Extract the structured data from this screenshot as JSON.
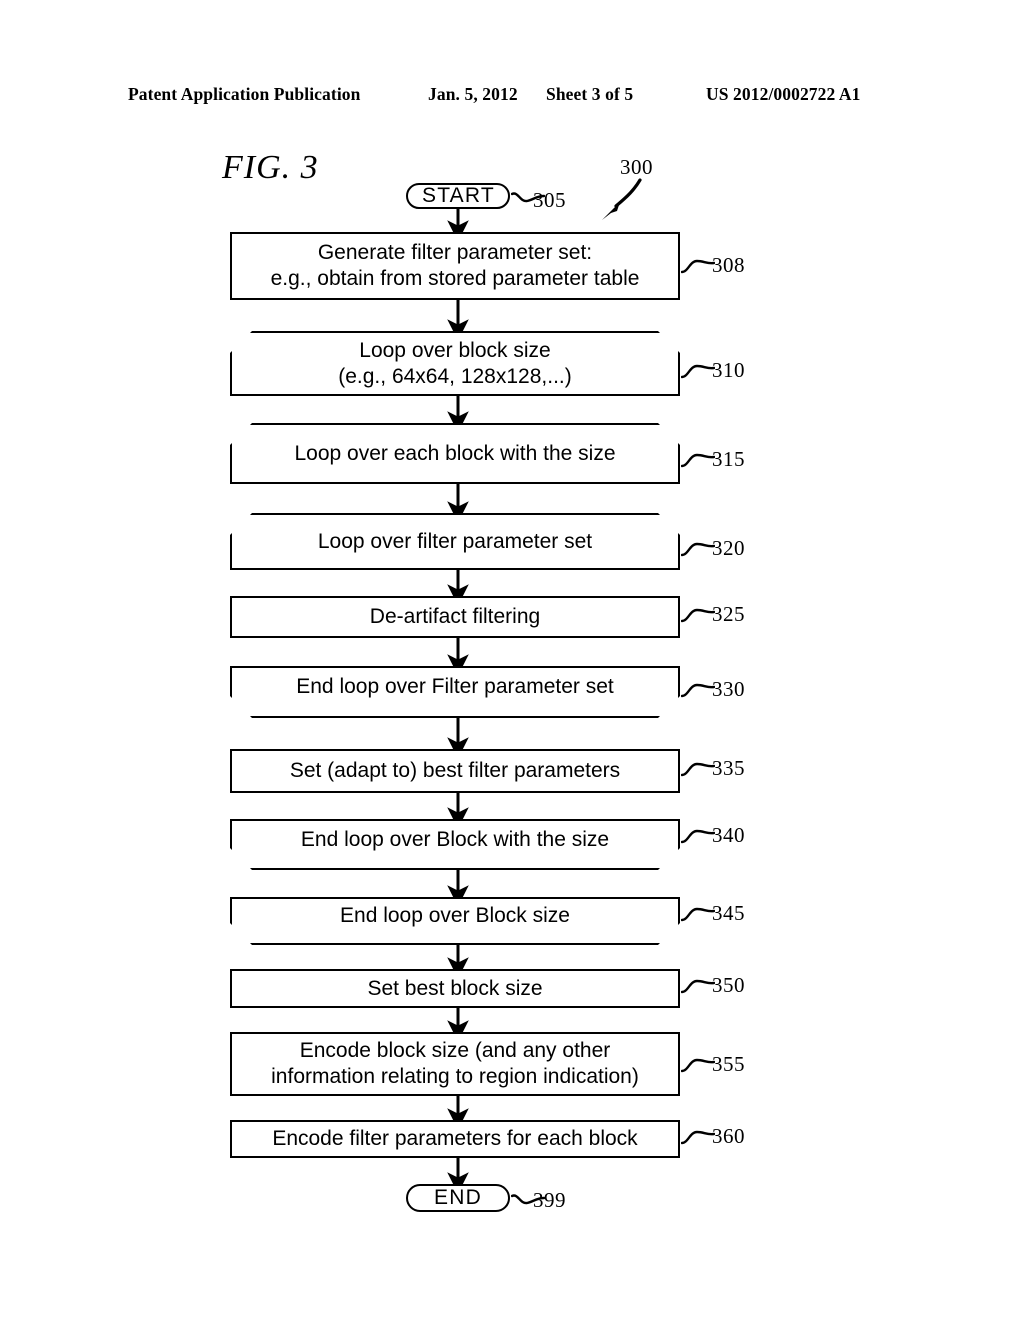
{
  "header": {
    "publication": "Patent Application Publication",
    "date": "Jan. 5, 2012",
    "sheet": "Sheet 3 of 5",
    "patent_number": "US 2012/0002722 A1"
  },
  "figure": {
    "title": "FIG. 3",
    "diagram_reference": "300"
  },
  "flowchart": {
    "type": "flowchart",
    "nodes": [
      {
        "id": "305",
        "shape": "terminator",
        "label": "START"
      },
      {
        "id": "308",
        "shape": "process",
        "label": "Generate filter parameter set:\ne.g., obtain from stored parameter table"
      },
      {
        "id": "310",
        "shape": "loop-start",
        "label": "Loop over block size\n(e.g., 64x64, 128x128,...)"
      },
      {
        "id": "315",
        "shape": "loop-start",
        "label": "Loop over each block with the size"
      },
      {
        "id": "320",
        "shape": "loop-start",
        "label": "Loop over filter parameter set"
      },
      {
        "id": "325",
        "shape": "process",
        "label": "De-artifact filtering"
      },
      {
        "id": "330",
        "shape": "loop-end",
        "label": "End loop over Filter parameter set"
      },
      {
        "id": "335",
        "shape": "process",
        "label": "Set (adapt to) best filter parameters"
      },
      {
        "id": "340",
        "shape": "loop-end",
        "label": "End loop over Block with the size"
      },
      {
        "id": "345",
        "shape": "loop-end",
        "label": "End loop over Block size"
      },
      {
        "id": "350",
        "shape": "process",
        "label": "Set best block size"
      },
      {
        "id": "355",
        "shape": "process",
        "label": "Encode block size (and any other\ninformation relating to region indication)"
      },
      {
        "id": "360",
        "shape": "process",
        "label": "Encode filter parameters for each block"
      },
      {
        "id": "399",
        "shape": "terminator",
        "label": "END"
      }
    ],
    "edges": [
      {
        "from": "305",
        "to": "308"
      },
      {
        "from": "308",
        "to": "310"
      },
      {
        "from": "310",
        "to": "315"
      },
      {
        "from": "315",
        "to": "320"
      },
      {
        "from": "320",
        "to": "325"
      },
      {
        "from": "325",
        "to": "330"
      },
      {
        "from": "330",
        "to": "335"
      },
      {
        "from": "335",
        "to": "340"
      },
      {
        "from": "340",
        "to": "345"
      },
      {
        "from": "345",
        "to": "350"
      },
      {
        "from": "350",
        "to": "355"
      },
      {
        "from": "355",
        "to": "360"
      },
      {
        "from": "360",
        "to": "399"
      }
    ]
  },
  "colors": {
    "ink": "#000000",
    "paper": "#ffffff"
  }
}
